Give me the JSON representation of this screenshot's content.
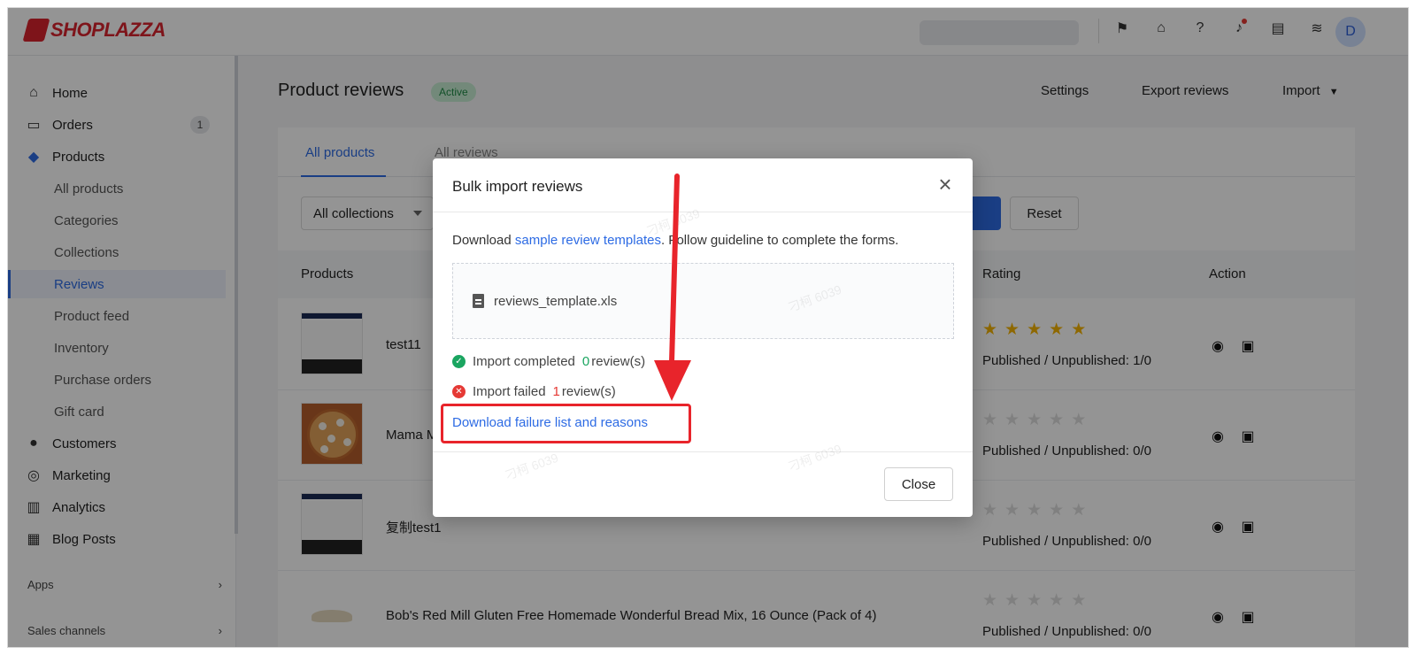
{
  "brand": {
    "name": "SHOPLAZZA"
  },
  "topbar": {
    "icons": [
      "flag-icon",
      "store-icon",
      "help-icon",
      "bell-icon",
      "message-icon",
      "wifi-icon"
    ],
    "avatar_initial": "D"
  },
  "sidebar": {
    "items": [
      {
        "label": "Home",
        "icon": "home-icon"
      },
      {
        "label": "Orders",
        "icon": "inbox-icon",
        "badge": "1"
      },
      {
        "label": "Products",
        "icon": "tag-icon"
      },
      {
        "label": "All products"
      },
      {
        "label": "Categories"
      },
      {
        "label": "Collections"
      },
      {
        "label": "Reviews",
        "active": true
      },
      {
        "label": "Product feed"
      },
      {
        "label": "Inventory"
      },
      {
        "label": "Purchase orders"
      },
      {
        "label": "Gift card"
      },
      {
        "label": "Customers",
        "icon": "person-icon"
      },
      {
        "label": "Marketing",
        "icon": "megaphone-icon"
      },
      {
        "label": "Analytics",
        "icon": "bar-chart-icon"
      },
      {
        "label": "Blog Posts",
        "icon": "blog-icon"
      }
    ],
    "sections": [
      {
        "label": "Apps"
      },
      {
        "label": "Sales channels"
      }
    ]
  },
  "page": {
    "title": "Product reviews",
    "status": "Active",
    "actions": {
      "settings": "Settings",
      "export": "Export reviews",
      "import": "Import"
    }
  },
  "tabs": {
    "all_products": "All products",
    "all_reviews": "All reviews"
  },
  "filters": {
    "collection_select": "All collections",
    "reset": "Reset"
  },
  "table": {
    "headers": {
      "products": "Products",
      "rating": "Rating",
      "action": "Action"
    },
    "rows": [
      {
        "name": "test11",
        "rating": 5,
        "published": "Published / Unpublished: 1/0"
      },
      {
        "name": "Mama M",
        "rating": 0,
        "published": "Published / Unpublished: 0/0"
      },
      {
        "name": "复制test1",
        "rating": 0,
        "published": "Published / Unpublished: 0/0"
      },
      {
        "name": "Bob's Red Mill Gluten Free Homemade Wonderful Bread Mix, 16 Ounce (Pack of 4)",
        "rating": 0,
        "published": "Published / Unpublished: 0/0"
      }
    ]
  },
  "modal": {
    "title": "Bulk import reviews",
    "guide_prefix": "Download ",
    "guide_link": "sample review templates",
    "guide_suffix": ". Follow guideline to complete the forms.",
    "file_name": "reviews_template.xls",
    "completed_label": "Import completed",
    "completed_count": "0",
    "failed_label": "Import failed",
    "failed_count": "1",
    "reviews_unit": "review(s)",
    "download_link": "Download failure list and reasons",
    "close": "Close",
    "watermark": "刁柯 6039"
  },
  "colors": {
    "accent": "#2d6be4",
    "brand_red": "#d9232e",
    "star": "#f5b301",
    "success": "#1aa560",
    "error": "#e53935",
    "annotation": "#e8242b"
  }
}
